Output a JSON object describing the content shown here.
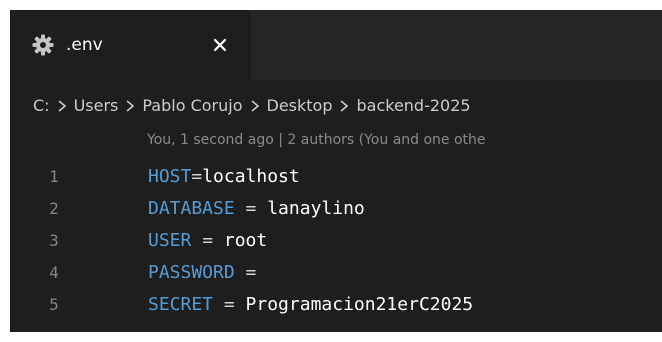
{
  "tab": {
    "title": ".env",
    "close_glyph": "×",
    "icon": "gear-icon",
    "close_icon": "close-icon"
  },
  "breadcrumb": {
    "items": [
      "C:",
      "Users",
      "Pablo Corujo",
      "Desktop",
      "backend-2025"
    ],
    "separator_icon": "chevron-right-icon"
  },
  "blame": {
    "text": "You, 1 second ago | 2 authors (You and one othe"
  },
  "editor": {
    "lines": [
      {
        "number": "1",
        "key": "HOST",
        "op": "=",
        "value": "localhost"
      },
      {
        "number": "2",
        "key": "DATABASE",
        "op": " = ",
        "value": "lanaylino"
      },
      {
        "number": "3",
        "key": "USER",
        "op": " = ",
        "value": "root"
      },
      {
        "number": "4",
        "key": "PASSWORD",
        "op": " =",
        "value": ""
      },
      {
        "number": "5",
        "key": "SECRET",
        "op": " = ",
        "value": "Programacion21erC2025"
      }
    ]
  },
  "colors": {
    "editor_bg": "#1e1e1e",
    "tabbar_bg": "#252526",
    "key": "#569cd6",
    "line_number": "#858585",
    "gear": "#c5c5c5"
  }
}
